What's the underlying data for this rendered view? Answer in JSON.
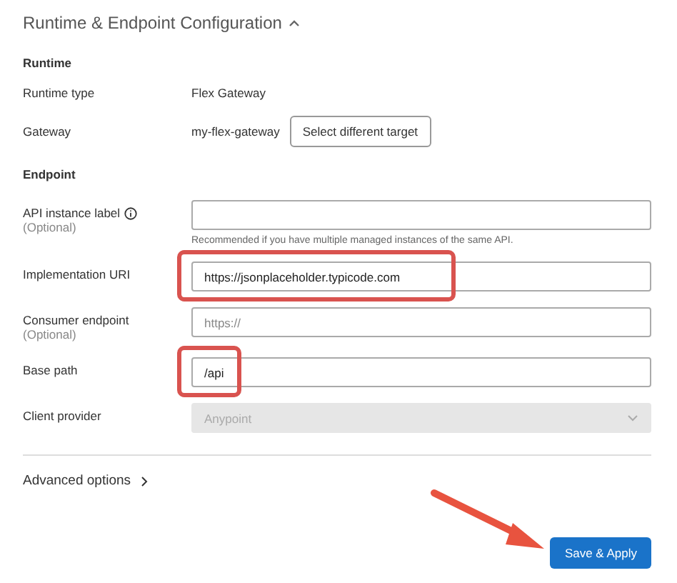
{
  "section": {
    "title": "Runtime & Endpoint Configuration",
    "expanded": true
  },
  "runtime": {
    "heading": "Runtime",
    "rows": [
      {
        "label": "Runtime type",
        "value": "Flex Gateway"
      },
      {
        "label": "Gateway",
        "value": "my-flex-gateway",
        "button": "Select different target"
      }
    ]
  },
  "endpoint": {
    "heading": "Endpoint",
    "fields": [
      {
        "kind": "text",
        "label": "API instance label",
        "info": true,
        "optional": "(Optional)",
        "hint": "Recommended if you have multiple managed instances of the same API.",
        "highlighted": false,
        "disabled": false
      },
      {
        "kind": "text",
        "label": "Implementation URI",
        "value": "https://jsonplaceholder.typicode.com",
        "highlighted": true,
        "disabled": false
      },
      {
        "kind": "text",
        "label": "Consumer endpoint",
        "optional": "(Optional)",
        "placeholder": "https://",
        "highlighted": false,
        "disabled": false
      },
      {
        "kind": "text",
        "label": "Base path",
        "value": "/api",
        "highlighted": true,
        "disabled": false
      },
      {
        "kind": "select",
        "label": "Client provider",
        "value": "Anypoint",
        "highlighted": false,
        "disabled": true
      }
    ]
  },
  "advanced": {
    "label": "Advanced options",
    "expanded": false
  },
  "save_button": {
    "label": "Save & Apply",
    "arrow_pointing": true
  }
}
